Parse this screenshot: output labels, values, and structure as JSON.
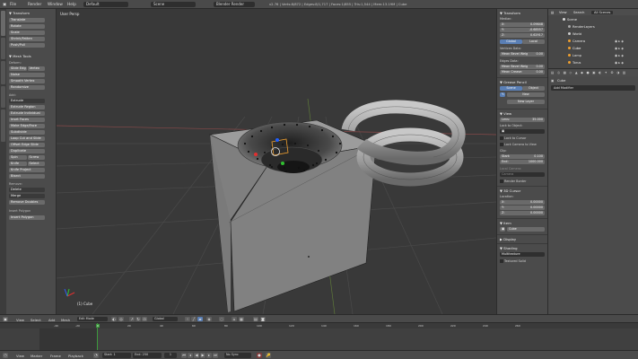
{
  "topbar": {
    "menus": [
      "File",
      "Render",
      "Window",
      "Help"
    ],
    "layout": "Default",
    "scene": "Scene",
    "engine": "Blender Render",
    "stats": "v2.76 | Verts:8/872 | Edges:8/1,717 | Faces:1/855 | Tris:1,544 | Mem:13.19M | Cube"
  },
  "left": {
    "tabs": [
      "Tools",
      "Create",
      "Shading",
      "Options",
      "Grease Pencil"
    ],
    "transform_header": "▼ Transform",
    "transform": [
      "Translate",
      "Rotate",
      "Scale",
      "Shrink/Fatten",
      "Push/Pull"
    ],
    "meshtools_header": "▼ Mesh Tools",
    "deform_label": "Deform:",
    "slide_edge": "Slide Edg",
    "vertex": "Vertex",
    "deform": [
      "Noise",
      "Smooth Vertex",
      "Randomize"
    ],
    "add_label": "Add:",
    "extrude_dropdown": "Extrude",
    "add": [
      "Extrude Region",
      "Extrude Individual",
      "Inset Faces",
      "Make Edge/Face",
      "Subdivide",
      "Loop Cut and Slide",
      "Offset Edge Slide",
      "Duplicate"
    ],
    "spin": "Spin",
    "screw": "Screw",
    "knife": "Knife",
    "select": "Select",
    "knife_project": "Knife Project",
    "bisect": "Bisect",
    "remove_label": "Remove:",
    "delete": "Delete",
    "merge": "Merge",
    "remove_doubles": "Remove Doubles",
    "history": "Insert Polygon",
    "insert_polygon": "Insert Polygon"
  },
  "viewport": {
    "view_label": "User Persp",
    "object_label": "(1) Cube"
  },
  "npanel": {
    "transform_header": "▼ Transform",
    "median": "Median:",
    "x": "X:",
    "x_val": "0.09648",
    "y": "Y:",
    "y_val": "-0.68557",
    "z": "Z:",
    "z_val": "0.62917",
    "global": "Global",
    "local": "Local",
    "vertices_data": "Vertices Data:",
    "mean_bevel_weight": "Mean Bevel Weig",
    "mbw_val": "0.00",
    "edges_data": "Edges Data:",
    "mean_bevel_edge": "Mean Bevel Weig",
    "mbe_val": "0.00",
    "mean_crease": "Mean Crease:",
    "crease_val": "0.00",
    "grease_header": "▼ Grease Pencil",
    "scene_btn": "Scene",
    "object_btn": "Object",
    "new_btn": "New",
    "new_layer": "New Layer",
    "view_header": "▼ View",
    "lens": "Lens:",
    "lens_val": "35.000",
    "lock_object": "Lock to Object:",
    "lock_cursor": "Lock to Cursor",
    "lock_camera": "Lock Camera to View",
    "clip": "Clip:",
    "start": "Start:",
    "start_val": "0.100",
    "end": "End:",
    "end_val": "1000.000",
    "local_camera": "Local Camera:",
    "camera": "Camera",
    "render_border": "Render Border",
    "cursor_header": "▼ 3D Cursor",
    "location": "Location:",
    "cx": "X:",
    "cx_val": "0.00000",
    "cy": "Y:",
    "cy_val": "0.00000",
    "cz": "Z:",
    "cz_val": "0.00000",
    "item_header": "▼ Item",
    "item_name": "Cube",
    "display_header": "▶ Display",
    "shading_header": "▼ Shading",
    "shading_mode": "Multitexture",
    "textured_solid": "Textured Solid"
  },
  "outliner": {
    "view": "View",
    "search": "Search",
    "scope": "All Scenes",
    "items": [
      "Scene",
      "RenderLayers",
      "World",
      "Camera",
      "Cube",
      "Lamp",
      "Torus"
    ]
  },
  "props": {
    "object_name": "Cube",
    "add_modifier": "Add Modifier"
  },
  "vp_header": {
    "menus": [
      "View",
      "Select",
      "Add",
      "Mesh"
    ],
    "mode": "Edit Mode",
    "orientation": "Global"
  },
  "timeline": {
    "ticks": [
      "-40",
      "-20",
      "0",
      "20",
      "40",
      "60",
      "80",
      "100",
      "120",
      "140",
      "160",
      "180",
      "200",
      "220",
      "240",
      "260"
    ]
  },
  "tl_header": {
    "menus": [
      "View",
      "Marker",
      "Frame",
      "Playback"
    ],
    "start": "Start:",
    "start_val": "1",
    "end": "End:",
    "end_val": "250",
    "current": "1",
    "sync": "No Sync"
  },
  "colors": {
    "mesh_face": "#8f8f8f",
    "mesh_dark": "#6d6d6d",
    "grid": "#4b4b4b",
    "selected": "#f0a030"
  }
}
